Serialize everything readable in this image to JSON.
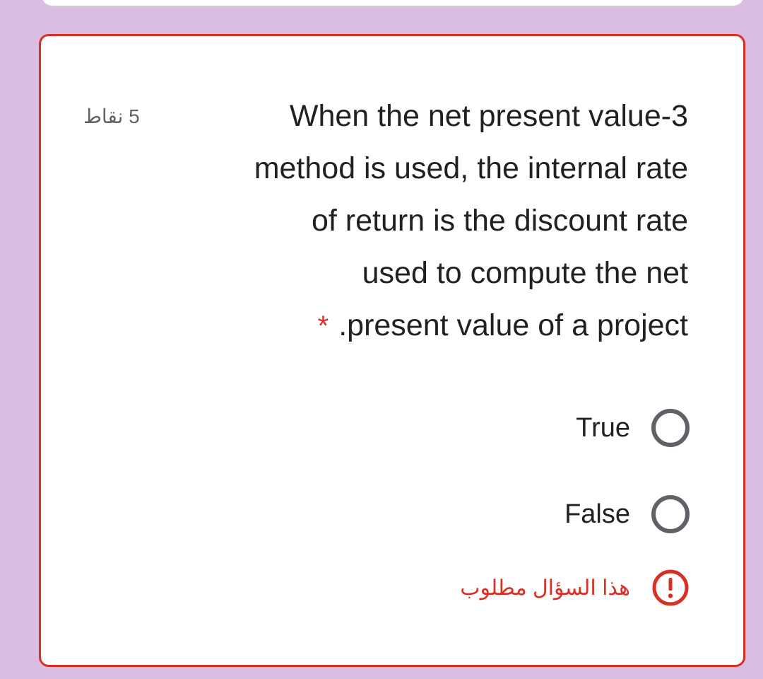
{
  "question": {
    "points_label": "5 نقاط",
    "lines": [
      "When the net present value-3",
      "method is used, the internal rate",
      "of return is the discount rate",
      "used to compute the net",
      ".present value of a project"
    ],
    "required_marker": "*"
  },
  "options": [
    {
      "label": "True",
      "selected": false
    },
    {
      "label": "False",
      "selected": false
    }
  ],
  "validation": {
    "message": "هذا السؤال مطلوب",
    "icon": "alert-circle-icon"
  },
  "colors": {
    "background": "#dbbde2",
    "error": "#d93025",
    "text": "#202124",
    "muted": "#5f6368"
  }
}
